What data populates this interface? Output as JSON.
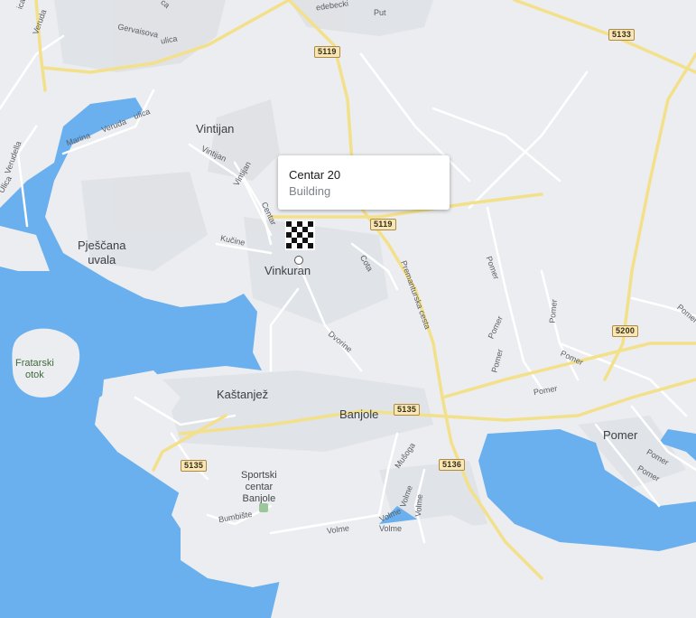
{
  "popup": {
    "title": "Centar 20",
    "subtitle": "Building"
  },
  "places": {
    "vintijan": "Vintijan",
    "vinkuran": "Vinkuran",
    "pjescana_line1": "Pješčana",
    "pjescana_line2": "uvala",
    "kastanjez": "Kaštanjež",
    "banjole": "Banjole",
    "pomer": "Pomer",
    "sportski_line1": "Sportski",
    "sportski_line2": "centar",
    "sportski_line3": "Banjole",
    "fratarski_line1": "Fratarski",
    "fratarski_line2": "otok"
  },
  "streets": {
    "gervaisova": "Gervaisova",
    "ulica_top": "ulica",
    "veruda_top": "Veruda",
    "ulica_left": "Ulica",
    "verudella": "Verudella",
    "marina": "Marina",
    "veruda_mid": "Veruda",
    "ulica_mid": "ulica",
    "vintijan1": "Vintijan",
    "vintijan2": "Vintijan",
    "centar": "Centar",
    "kucine": "Kučine",
    "cota": "Cota",
    "premanturska": "Premanturska cesta",
    "dvorine": "Dvorine",
    "musoga": "Mušoga",
    "volme1": "Volme",
    "volme2": "Volme",
    "volme3": "Volme",
    "volme4": "Volme",
    "volme5": "Volme",
    "bumbiste": "Bumbište",
    "pomer1": "Pomer",
    "pomer2": "Pomer",
    "pomer3": "Pomer",
    "pomer4": "Pomer",
    "pomer5": "Pomer",
    "pomer6": "Pomer",
    "pomer7": "Pomer",
    "pomer8": "Pomer",
    "pomer9": "Pomer",
    "ledebecki": "edebecki",
    "put": "Put",
    "ica": "ica",
    "ca": "ca"
  },
  "shields": {
    "s5119a": "5119",
    "s5119b": "5119",
    "s5133": "5133",
    "s5200": "5200",
    "s5135a": "5135",
    "s5135b": "5135",
    "s5136": "5136"
  },
  "icons": {
    "marker": "checkered-flag-icon",
    "park": "park-icon"
  },
  "colors": {
    "water": "#6ab0ee",
    "land": "#ecedf0",
    "road_major": "#f3e08a",
    "road_minor": "#ffffff",
    "shield_bg": "#f6e6b8"
  }
}
